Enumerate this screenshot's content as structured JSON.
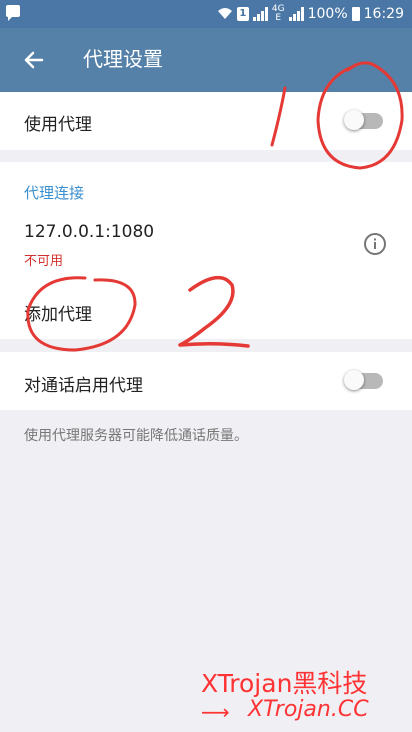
{
  "status_bar": {
    "sim_label": "1",
    "network": "4G",
    "network_sub": "E",
    "battery": "100%",
    "time": "16:29",
    "icons": [
      "message-icon",
      "wifi-icon",
      "sim-icon",
      "signal-icon",
      "battery-icon"
    ]
  },
  "header": {
    "title": "代理设置",
    "back_icon": "arrow-left-icon",
    "background": "#5580a8"
  },
  "use_proxy": {
    "label": "使用代理",
    "enabled": false
  },
  "proxy_list": {
    "header": "代理连接",
    "items": [
      {
        "address": "127.0.0.1:1080",
        "status": "不可用"
      }
    ],
    "add_label": "添加代理"
  },
  "calls_proxy": {
    "label": "对通话启用代理",
    "enabled": false
  },
  "footer_note": "使用代理服务器可能降低通话质量。",
  "annotations": [
    "1",
    "2"
  ],
  "watermark": {
    "line1": "XTrojan黑科技",
    "line2": "XTrojan.CC",
    "color": "#ff3333"
  },
  "colors": {
    "accent": "#3a8fd0",
    "error": "#d32f2f",
    "status_bar": "#4a77a5",
    "background": "#efeff4"
  }
}
